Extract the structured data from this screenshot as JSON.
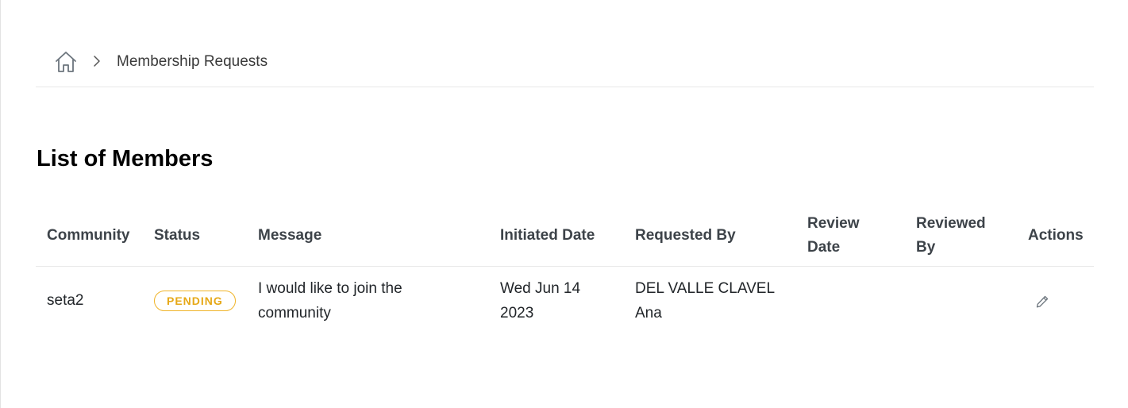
{
  "breadcrumb": {
    "home_icon": "home-icon",
    "separator_icon": "chevron-right-icon",
    "current": "Membership Requests"
  },
  "page": {
    "title": "List of Members"
  },
  "table": {
    "columns": [
      "Community",
      "Status",
      "Message",
      "Initiated Date",
      "Requested By",
      "Review Date",
      "Reviewed By",
      "Actions"
    ],
    "rows": [
      {
        "community": "seta2",
        "status": "PENDING",
        "message": "I would like to join the community",
        "initiated_date": "Wed Jun 14 2023",
        "requested_by": "DEL VALLE CLAVEL Ana",
        "review_date": "",
        "reviewed_by": "",
        "action_icon": "pencil-icon"
      }
    ]
  },
  "colors": {
    "status_pending": "#f0b429",
    "header_text": "#3d4349",
    "divider": "#e8e8e8"
  }
}
